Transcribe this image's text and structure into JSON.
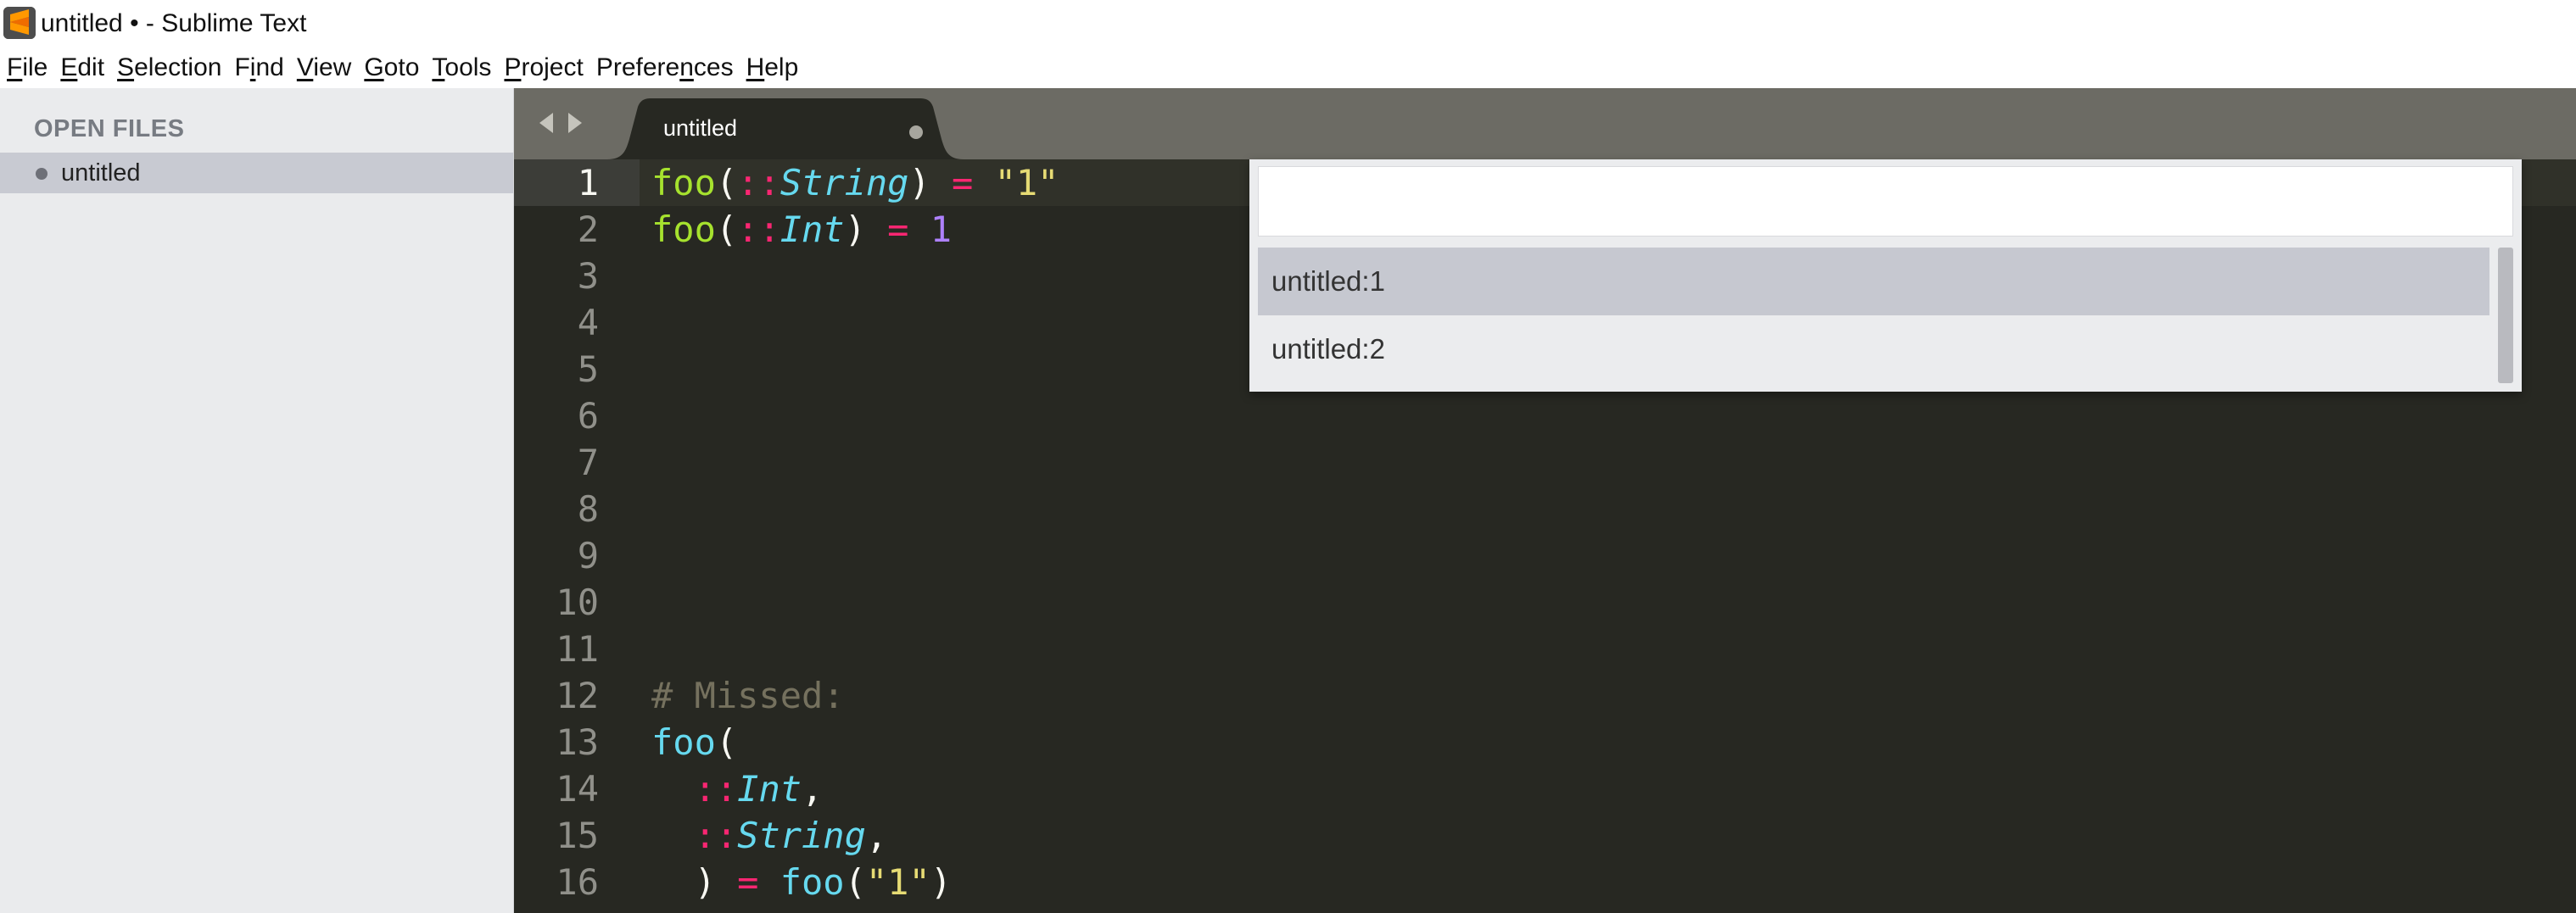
{
  "window": {
    "title": "untitled • - Sublime Text",
    "app_icon": "sublime-text-icon"
  },
  "menu": [
    {
      "pre": "",
      "mn": "F",
      "post": "ile"
    },
    {
      "pre": "",
      "mn": "E",
      "post": "dit"
    },
    {
      "pre": "",
      "mn": "S",
      "post": "election"
    },
    {
      "pre": "F",
      "mn": "i",
      "post": "nd"
    },
    {
      "pre": "",
      "mn": "V",
      "post": "iew"
    },
    {
      "pre": "",
      "mn": "G",
      "post": "oto"
    },
    {
      "pre": "",
      "mn": "T",
      "post": "ools"
    },
    {
      "pre": "",
      "mn": "P",
      "post": "roject"
    },
    {
      "pre": "Prefere",
      "mn": "n",
      "post": "ces"
    },
    {
      "pre": "",
      "mn": "H",
      "post": "elp"
    }
  ],
  "sidebar": {
    "heading": "OPEN FILES",
    "files": [
      {
        "name": "untitled",
        "dirty": true
      }
    ]
  },
  "tabs": [
    {
      "label": "untitled",
      "active": true,
      "dirty": true
    }
  ],
  "editor": {
    "active_line": 1,
    "line_numbers": [
      "1",
      "2",
      "3",
      "4",
      "5",
      "6",
      "7",
      "8",
      "9",
      "10",
      "11",
      "12",
      "13",
      "14",
      "15",
      "16"
    ],
    "lines": {
      "l1": {
        "fn": "foo",
        "open": "(",
        "op": "::",
        "type": "String",
        "close": ")",
        "eq": " = ",
        "value": "\"1\""
      },
      "l2": {
        "fn": "foo",
        "open": "(",
        "op": "::",
        "type": "Int",
        "close": ")",
        "eq": " = ",
        "value": "1"
      },
      "l12": {
        "comment": "# Missed:"
      },
      "l13": {
        "fn": "foo",
        "open": "("
      },
      "l14": {
        "indent": "  ",
        "op": "::",
        "type": "Int",
        "comma": ","
      },
      "l15": {
        "indent": "  ",
        "op": "::",
        "type": "String",
        "comma": ","
      },
      "l16": {
        "indent": "  ",
        "close": ")",
        "eq": " = ",
        "fn": "foo",
        "open": "(",
        "value": "\"1\"",
        "close2": ")"
      }
    }
  },
  "quick_panel": {
    "query": "",
    "items": [
      {
        "label": "untitled:1",
        "selected": true
      },
      {
        "label": "untitled:2",
        "selected": false
      }
    ]
  },
  "colors": {
    "editor_bg": "#272822",
    "tabbar_bg": "#6c6b64",
    "sidebar_bg": "#eaebed",
    "keyword": "#f92672",
    "type": "#66d9ef",
    "string": "#e6db74",
    "number": "#ae81ff",
    "function": "#a6e22e",
    "comment": "#75715e"
  }
}
